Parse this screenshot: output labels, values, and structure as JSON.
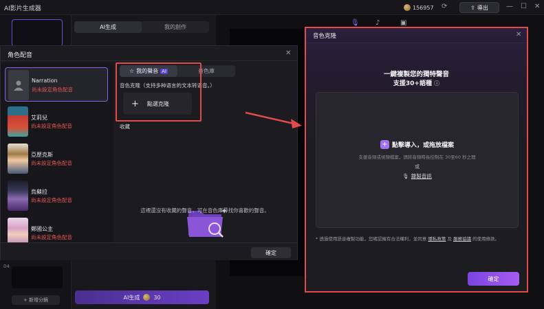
{
  "app": {
    "title": "AI影片生成器",
    "credits": "156957",
    "export_label": "導出",
    "minimize": "—",
    "maximize": "☐",
    "close": "✕"
  },
  "left_panel": {
    "scene_number": "04",
    "add_scene_label": "+ 新增分鏡"
  },
  "mid_panel": {
    "tabs": [
      "AI生成",
      "我的創作"
    ],
    "generate_label": "AI生成",
    "generate_cost": "30"
  },
  "voice_dialog": {
    "title": "角色配音",
    "characters": [
      {
        "name": "Narration",
        "status": "尚未設定角色配音"
      },
      {
        "name": "艾莉兒",
        "status": "尚未設定角色配音"
      },
      {
        "name": "亞歷克斯",
        "status": "尚未設定角色配音"
      },
      {
        "name": "烏蘇拉",
        "status": "尚未設定角色配音"
      },
      {
        "name": "鄭國公主",
        "status": "尚未設定角色配音"
      }
    ],
    "tabs": {
      "my_voice": "我的聲音",
      "ai_badge": "AI",
      "library": "音色庫"
    },
    "clone_section_label": "音色克隆（支持多种语言的文本转语音。）",
    "clone_button_label": "點選克隆",
    "favorites_label": "收藏",
    "empty_text": "這裡還沒有收藏的聲音，可在音色庫尋找你喜歡的聲音。",
    "confirm_label": "確定"
  },
  "clone_dialog": {
    "title": "音色克隆",
    "heading": "一鍵複製您的獨特聲音",
    "subheading": "支援30+語種",
    "import_label": "點擊導入，或拖放檔案",
    "import_hint": "支援音頻或視頻檔案，請將音頻時長控制在 30至60 秒之間",
    "or_label": "或",
    "record_label": "錄製音訊",
    "disclaimer_prefix": "* 透過使用語音複製功能，您確認擁有合法權利，並同意",
    "privacy_link": "隱私政策",
    "and_label": "及",
    "terms_link": "服務協議",
    "disclaimer_suffix": "的使用條款。",
    "confirm_label": "確定"
  },
  "colors": {
    "accent_purple": "#8462e6",
    "annotation_red": "#e24b4b",
    "status_red": "#e25454"
  }
}
